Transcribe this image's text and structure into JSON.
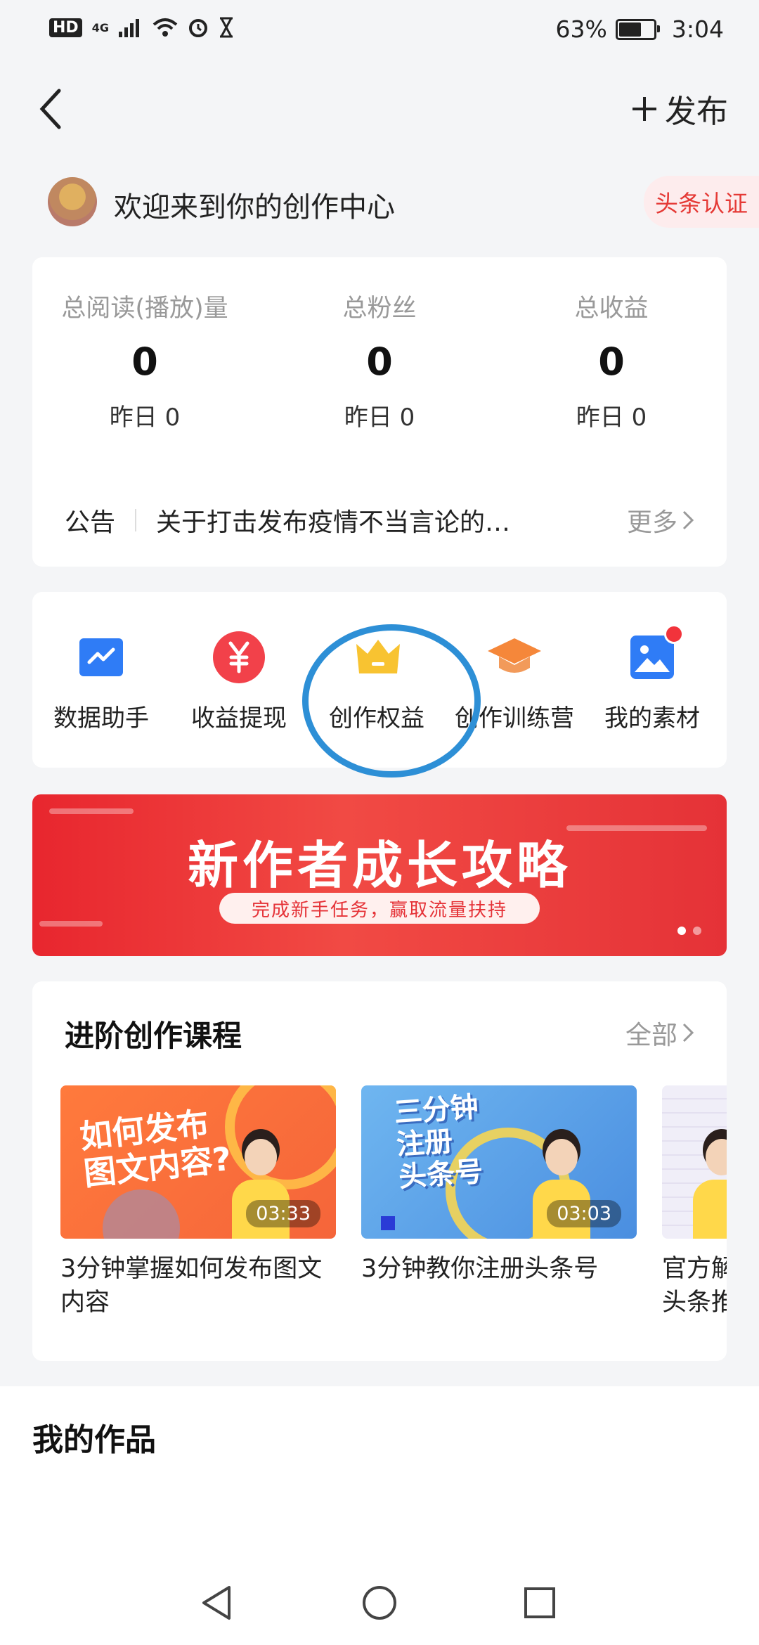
{
  "status_bar": {
    "hd": "HD",
    "network": "4G",
    "battery_percent": "63%",
    "time": "3:04",
    "icons": [
      "signal-icon",
      "wifi-icon",
      "alarm-icon",
      "hourglass-icon",
      "battery-icon"
    ]
  },
  "header": {
    "back_icon": "chevron-left-icon",
    "publish_label": "发布"
  },
  "welcome": {
    "text": "欢迎来到你的创作中心",
    "cert_label": "头条认证"
  },
  "stats": [
    {
      "label": "总阅读(播放)量",
      "value": "0",
      "yesterday": "昨日 0"
    },
    {
      "label": "总粉丝",
      "value": "0",
      "yesterday": "昨日 0"
    },
    {
      "label": "总收益",
      "value": "0",
      "yesterday": "昨日 0"
    }
  ],
  "notice": {
    "label": "公告",
    "text": "关于打击发布疫情不当言论的…",
    "more": "更多"
  },
  "tools": [
    {
      "label": "数据助手",
      "icon": "chart-icon",
      "color": "#2f7cf6"
    },
    {
      "label": "收益提现",
      "icon": "yuan-icon",
      "color": "#f2414a"
    },
    {
      "label": "创作权益",
      "icon": "crown-icon",
      "color": "#f8c331"
    },
    {
      "label": "创作训练营",
      "icon": "graduation-cap-icon",
      "color": "#f5873a"
    },
    {
      "label": "我的素材",
      "icon": "image-icon",
      "color": "#2f7cf6",
      "has_dot": true
    }
  ],
  "banner": {
    "title": "新作者成长攻略",
    "subtitle": "完成新手任务，赢取流量扶持",
    "active_dot": 0
  },
  "courses": {
    "title": "进阶创作课程",
    "all_label": "全部",
    "items": [
      {
        "thumb_title": "如何发布\n图文内容?",
        "duration": "03:33",
        "title": "3分钟掌握如何发布图文内容"
      },
      {
        "thumb_title": "三分钟\n注册\n头条号",
        "duration": "03:03",
        "title": "3分钟教你注册头条号"
      },
      {
        "thumb_title": "",
        "duration": "",
        "title": "官方解\n头条推"
      }
    ]
  },
  "works": {
    "title": "我的作品"
  },
  "nav": {
    "icons": [
      "nav-back-icon",
      "nav-home-icon",
      "nav-recent-icon"
    ]
  },
  "colors": {
    "accent_red": "#e53935",
    "annotation_blue": "#2d8fd6"
  }
}
